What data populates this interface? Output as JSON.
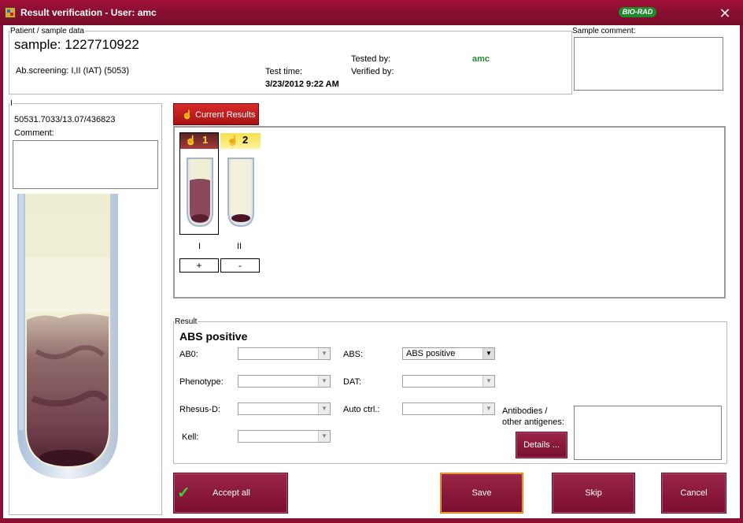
{
  "window": {
    "title": "Result verification - User: amc",
    "logo": "BIO-RAD"
  },
  "patient": {
    "legend": "Patient / sample data",
    "sample": "sample: 1227710922",
    "ab_screening": "Ab.screening: I,II (IAT) (5053)",
    "tested_by_label": "Tested by:",
    "tested_by_value": "amc",
    "verified_by_label": "Verified by:",
    "test_time_label": "Test time:",
    "test_time_value": "3/23/2012 9:22 AM"
  },
  "sample_comment": {
    "legend": "Sample comment:"
  },
  "card": {
    "legend": "I",
    "id": "50531.7033/13.07/436823",
    "comment_label": "Comment:"
  },
  "tabs": {
    "current_results": "Current Results"
  },
  "wells": [
    {
      "number": "1",
      "label": "I",
      "result": "+"
    },
    {
      "number": "2",
      "label": "II",
      "result": "-"
    }
  ],
  "result": {
    "legend": "Result",
    "heading": "ABS positive",
    "abo_label": "AB0:",
    "abs_label": "ABS:",
    "abs_value": "ABS positive",
    "phenotype_label": "Phenotype:",
    "dat_label": "DAT:",
    "rhesus_label": "Rhesus-D:",
    "auto_ctrl_label": "Auto ctrl.:",
    "kell_label": "Kell:",
    "antibodies_label_1": "Antibodies /",
    "antibodies_label_2": "other antigenes:",
    "details_button": "Details ..."
  },
  "buttons": {
    "accept_all": "Accept all",
    "save": "Save",
    "skip": "Skip",
    "cancel": "Cancel"
  },
  "colors": {
    "brand": "#8a0f30",
    "accent_green": "#1f8a2e"
  }
}
